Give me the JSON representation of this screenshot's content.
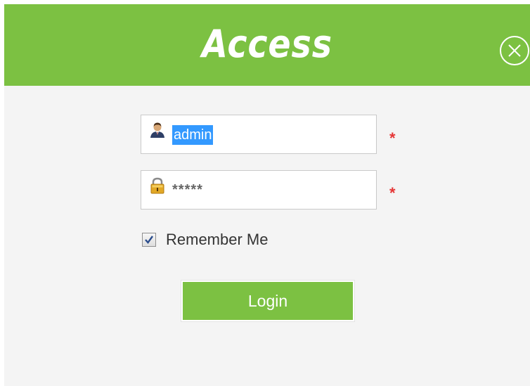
{
  "dialog": {
    "title": "Access"
  },
  "form": {
    "username": {
      "value": "admin",
      "icon": "user-icon"
    },
    "password": {
      "masked_value": "*****",
      "icon": "lock-icon"
    },
    "required_marker": "*",
    "remember_me": {
      "label": "Remember Me",
      "checked": true
    },
    "login_label": "Login"
  },
  "colors": {
    "accent": "#7cc142",
    "required": "#e53535",
    "selection": "#3399ff",
    "background": "#f4f4f4"
  }
}
